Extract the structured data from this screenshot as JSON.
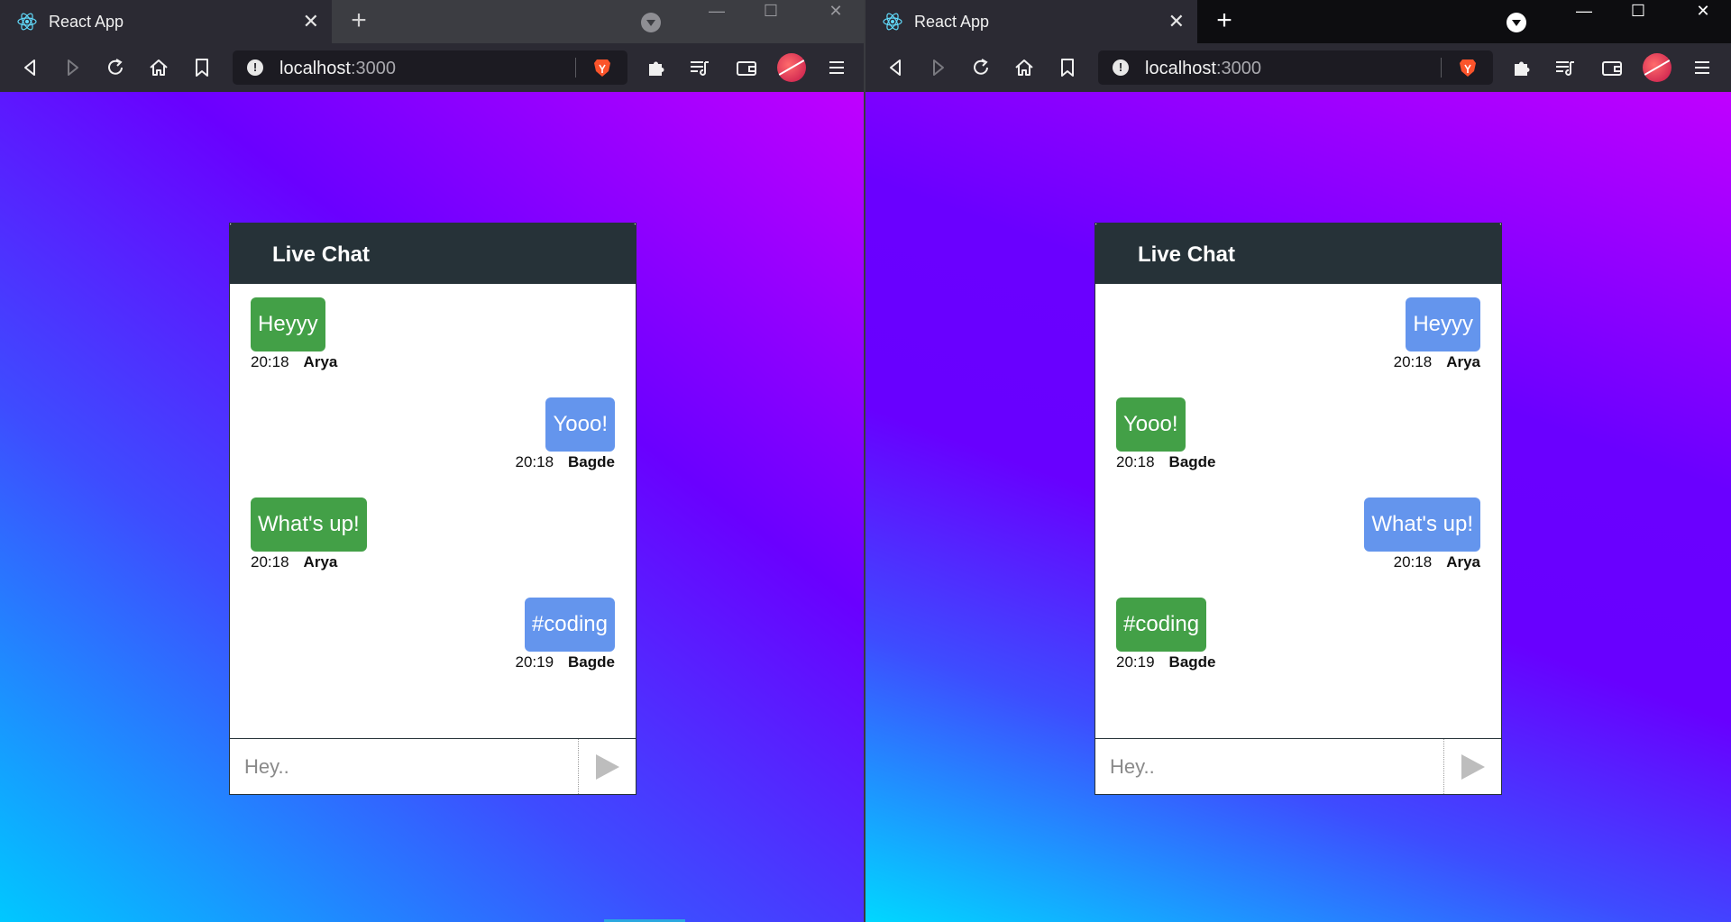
{
  "windows": [
    {
      "tab": {
        "title": "React App",
        "icon": "react-icon",
        "close": "✕"
      },
      "newtab": "+",
      "controls": {
        "minimize": "—",
        "maximize": "☐",
        "close": "✕"
      },
      "url": {
        "host": "localhost",
        "port": ":3000"
      },
      "chat": {
        "title": "Live Chat",
        "input_placeholder": "Hey..",
        "messages": [
          {
            "text": "Heyyy",
            "time": "20:18",
            "author": "Arya",
            "side": "left",
            "color": "green"
          },
          {
            "text": "Yooo!",
            "time": "20:18",
            "author": "Bagde",
            "side": "right",
            "color": "blue"
          },
          {
            "text": "What's up!",
            "time": "20:18",
            "author": "Arya",
            "side": "left",
            "color": "green"
          },
          {
            "text": "#coding",
            "time": "20:19",
            "author": "Bagde",
            "side": "right",
            "color": "blue"
          }
        ]
      }
    },
    {
      "tab": {
        "title": "React App",
        "icon": "react-icon",
        "close": "✕"
      },
      "newtab": "+",
      "controls": {
        "minimize": "—",
        "maximize": "☐",
        "close": "✕"
      },
      "url": {
        "host": "localhost",
        "port": ":3000"
      },
      "chat": {
        "title": "Live Chat",
        "input_placeholder": "Hey..",
        "messages": [
          {
            "text": "Heyyy",
            "time": "20:18",
            "author": "Arya",
            "side": "right",
            "color": "blue"
          },
          {
            "text": "Yooo!",
            "time": "20:18",
            "author": "Bagde",
            "side": "left",
            "color": "green"
          },
          {
            "text": "What's up!",
            "time": "20:18",
            "author": "Arya",
            "side": "right",
            "color": "blue"
          },
          {
            "text": "#coding",
            "time": "20:19",
            "author": "Bagde",
            "side": "left",
            "color": "green"
          }
        ]
      }
    }
  ],
  "colors": {
    "own_bubble": "#6495ed",
    "other_bubble": "#43a047",
    "chat_header": "#263238"
  }
}
